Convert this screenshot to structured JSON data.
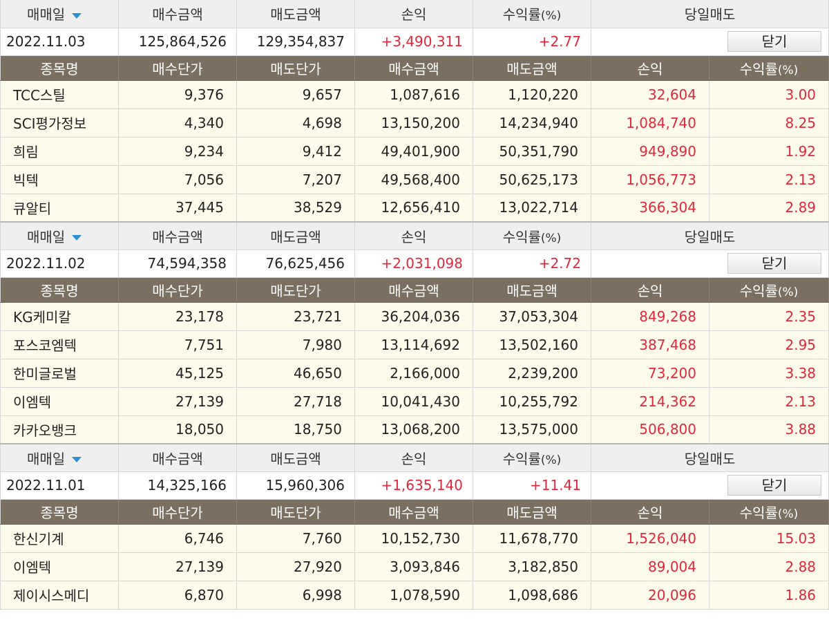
{
  "summary_headers": {
    "date": "매매일",
    "buy_amount": "매수금액",
    "sell_amount": "매도금액",
    "pnl": "손익",
    "return_pct": "수익률",
    "return_unit": "(%)",
    "day_sell": "당일매도"
  },
  "detail_headers": {
    "name": "종목명",
    "buy_price": "매수단가",
    "sell_price": "매도단가",
    "buy_amount": "매수금액",
    "sell_amount": "매도금액",
    "pnl": "손익",
    "return_pct": "수익률",
    "return_unit": "(%)"
  },
  "close_label": "닫기",
  "days": [
    {
      "date": "2022.11.03",
      "buy_amount": "125,864,526",
      "sell_amount": "129,354,837",
      "pnl": "+3,490,311",
      "return_pct": "+2.77",
      "stocks": [
        {
          "name": "TCC스틸",
          "buy_price": "9,376",
          "sell_price": "9,657",
          "buy_amount": "1,087,616",
          "sell_amount": "1,120,220",
          "pnl": "32,604",
          "return_pct": "3.00"
        },
        {
          "name": "SCI평가정보",
          "buy_price": "4,340",
          "sell_price": "4,698",
          "buy_amount": "13,150,200",
          "sell_amount": "14,234,940",
          "pnl": "1,084,740",
          "return_pct": "8.25"
        },
        {
          "name": "희림",
          "buy_price": "9,234",
          "sell_price": "9,412",
          "buy_amount": "49,401,900",
          "sell_amount": "50,351,790",
          "pnl": "949,890",
          "return_pct": "1.92"
        },
        {
          "name": "빅텍",
          "buy_price": "7,056",
          "sell_price": "7,207",
          "buy_amount": "49,568,400",
          "sell_amount": "50,625,173",
          "pnl": "1,056,773",
          "return_pct": "2.13"
        },
        {
          "name": "큐알티",
          "buy_price": "37,445",
          "sell_price": "38,529",
          "buy_amount": "12,656,410",
          "sell_amount": "13,022,714",
          "pnl": "366,304",
          "return_pct": "2.89"
        }
      ]
    },
    {
      "date": "2022.11.02",
      "buy_amount": "74,594,358",
      "sell_amount": "76,625,456",
      "pnl": "+2,031,098",
      "return_pct": "+2.72",
      "stocks": [
        {
          "name": "KG케미칼",
          "buy_price": "23,178",
          "sell_price": "23,721",
          "buy_amount": "36,204,036",
          "sell_amount": "37,053,304",
          "pnl": "849,268",
          "return_pct": "2.35"
        },
        {
          "name": "포스코엠텍",
          "buy_price": "7,751",
          "sell_price": "7,980",
          "buy_amount": "13,114,692",
          "sell_amount": "13,502,160",
          "pnl": "387,468",
          "return_pct": "2.95"
        },
        {
          "name": "한미글로벌",
          "buy_price": "45,125",
          "sell_price": "46,650",
          "buy_amount": "2,166,000",
          "sell_amount": "2,239,200",
          "pnl": "73,200",
          "return_pct": "3.38"
        },
        {
          "name": "이엠텍",
          "buy_price": "27,139",
          "sell_price": "27,718",
          "buy_amount": "10,041,430",
          "sell_amount": "10,255,792",
          "pnl": "214,362",
          "return_pct": "2.13"
        },
        {
          "name": "카카오뱅크",
          "buy_price": "18,050",
          "sell_price": "18,750",
          "buy_amount": "13,068,200",
          "sell_amount": "13,575,000",
          "pnl": "506,800",
          "return_pct": "3.88"
        }
      ]
    },
    {
      "date": "2022.11.01",
      "buy_amount": "14,325,166",
      "sell_amount": "15,960,306",
      "pnl": "+1,635,140",
      "return_pct": "+11.41",
      "stocks": [
        {
          "name": "한신기계",
          "buy_price": "6,746",
          "sell_price": "7,760",
          "buy_amount": "10,152,730",
          "sell_amount": "11,678,770",
          "pnl": "1,526,040",
          "return_pct": "15.03"
        },
        {
          "name": "이엠텍",
          "buy_price": "27,139",
          "sell_price": "27,920",
          "buy_amount": "3,093,846",
          "sell_amount": "3,182,850",
          "pnl": "89,004",
          "return_pct": "2.88"
        },
        {
          "name": "제이시스메디",
          "buy_price": "6,870",
          "sell_price": "6,998",
          "buy_amount": "1,078,590",
          "sell_amount": "1,098,686",
          "pnl": "20,096",
          "return_pct": "1.86"
        }
      ]
    }
  ]
}
